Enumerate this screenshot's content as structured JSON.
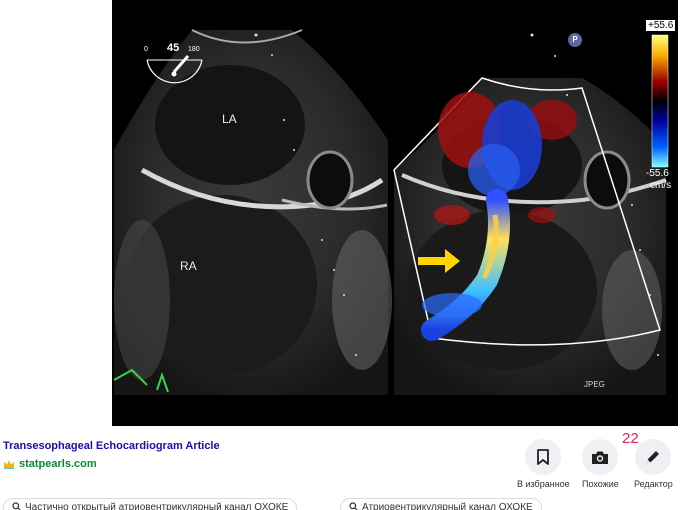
{
  "viewer": {
    "labels": {
      "la": "LA",
      "ra": "RA"
    },
    "angle": {
      "min": "0",
      "value": "45",
      "max": "180"
    },
    "probe_badge": "P",
    "color_scale": {
      "top": "+55.6",
      "bottom": "-55.6",
      "unit": "cm/s"
    },
    "format_tag": "JPEG"
  },
  "result": {
    "title": "Transesophageal Echocardiogram Article",
    "source": "statpearls.com",
    "counter": "22"
  },
  "actions": [
    {
      "label": "В избранное",
      "icon": "bookmark-icon"
    },
    {
      "label": "Похожие",
      "icon": "camera-icon"
    },
    {
      "label": "Редактор",
      "icon": "pencil-icon"
    }
  ],
  "chips": [
    {
      "text": "Частично открытый атриовентрикулярный канал ОХОКЕ"
    },
    {
      "text": "Атриовентрикулярный канал ОХОКЕ"
    }
  ],
  "colors": {
    "link": "#1a0dab",
    "source": "#0a8a3a",
    "counter": "#e0245e",
    "arrow": "#ffd400"
  }
}
